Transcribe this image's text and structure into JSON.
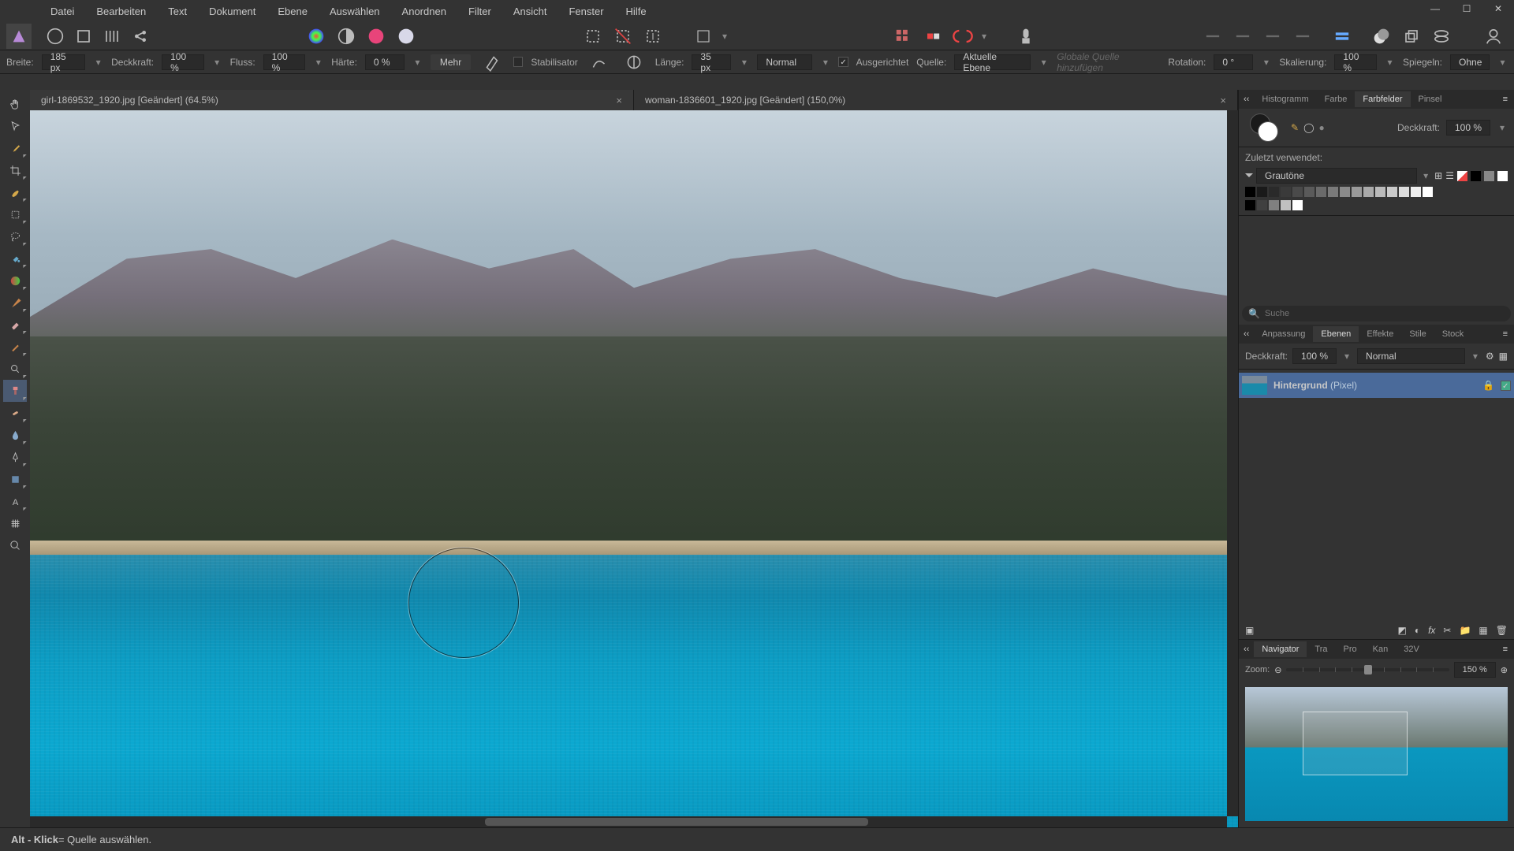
{
  "menubar": {
    "items": [
      "Datei",
      "Bearbeiten",
      "Text",
      "Dokument",
      "Ebene",
      "Auswählen",
      "Anordnen",
      "Filter",
      "Ansicht",
      "Fenster",
      "Hilfe"
    ]
  },
  "context": {
    "width_label": "Breite:",
    "width_value": "185 px",
    "opacity_label": "Deckkraft:",
    "opacity_value": "100 %",
    "flow_label": "Fluss:",
    "flow_value": "100 %",
    "hardness_label": "Härte:",
    "hardness_value": "0 %",
    "more_label": "Mehr",
    "stabilizer_label": "Stabilisator",
    "length_label": "Länge:",
    "length_value": "35 px",
    "blend_mode": "Normal",
    "aligned_label": "Ausgerichtet",
    "source_label": "Quelle:",
    "source_value": "Aktuelle Ebene",
    "global_placeholder": "Globale Quelle hinzufügen",
    "rotation_label": "Rotation:",
    "rotation_value": "0 °",
    "scale_label": "Skalierung:",
    "scale_value": "100 %",
    "mirror_label": "Spiegeln:",
    "mirror_value": "Ohne"
  },
  "tabs": [
    {
      "label": "girl-1869532_1920.jpg [Geändert] (64.5%)",
      "active": true
    },
    {
      "label": "woman-1836601_1920.jpg [Geändert] (150,0%)",
      "active": false
    }
  ],
  "right": {
    "top_tabs": [
      "Histogramm",
      "Farbe",
      "Farbfelder",
      "Pinsel"
    ],
    "top_active": "Farbfelder",
    "opacity_label": "Deckkraft:",
    "opacity_value": "100 %",
    "recent_label": "Zuletzt verwendet:",
    "palette_name": "Grautöne",
    "search_placeholder": "Suche",
    "mid_tabs": [
      "Anpassung",
      "Ebenen",
      "Effekte",
      "Stile",
      "Stock"
    ],
    "mid_active": "Ebenen",
    "layer_opacity_label": "Deckkraft:",
    "layer_opacity_value": "100 %",
    "layer_blend": "Normal",
    "layer_name": "Hintergrund",
    "layer_type": "(Pixel)",
    "bottom_tabs": [
      "Navigator",
      "Tra",
      "Pro",
      "Kan",
      "32V"
    ],
    "bottom_active": "Navigator",
    "zoom_label": "Zoom:",
    "zoom_value": "150 %"
  },
  "status": {
    "key": "Alt - Klick",
    "text": " = Quelle auswählen."
  },
  "colors": {
    "gray_swatches": [
      "#000000",
      "#1a1a1a",
      "#2a2a2a",
      "#3a3a3a",
      "#4a4a4a",
      "#5a5a5a",
      "#6a6a6a",
      "#7a7a7a",
      "#8a8a8a",
      "#9a9a9a",
      "#aaaaaa",
      "#bababa",
      "#cacaca",
      "#dddddd",
      "#eeeeee",
      "#ffffff"
    ],
    "gray_swatches2": [
      "#000000",
      "#404040",
      "#808080",
      "#c0c0c0",
      "#ffffff"
    ]
  }
}
